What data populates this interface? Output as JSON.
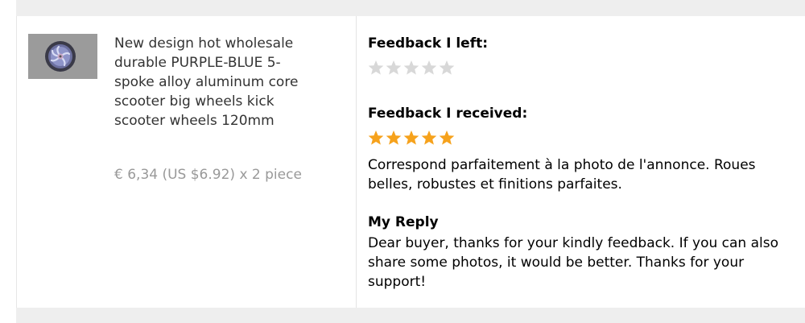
{
  "product": {
    "image_alt": "scooter wheel",
    "title": "New design hot wholesale durable PURPLE-BLUE 5-spoke alloy aluminum core scooter big wheels kick scooter wheels 120mm",
    "price_line": "€ 6,34 (US $6.92) x 2 piece"
  },
  "feedback_left": {
    "heading": "Feedback I left:",
    "stars_filled": 0,
    "stars_total": 5
  },
  "feedback_received": {
    "heading": "Feedback I received:",
    "stars_filled": 5,
    "stars_total": 5,
    "comment": "Correspond parfaitement à la photo de l'annonce. Roues belles, robustes et finitions parfaites."
  },
  "reply": {
    "heading": "My Reply",
    "text": "Dear buyer, thanks for your kindly feedback. If you can also share some photos, it would be better. Thanks for your support!"
  },
  "colors": {
    "star_filled": "#f6a21c",
    "star_empty": "#d8d8d8",
    "band": "#eeeeee",
    "price": "#999999"
  }
}
